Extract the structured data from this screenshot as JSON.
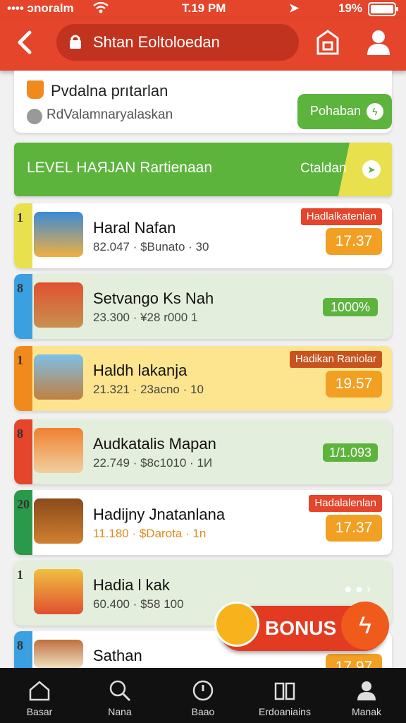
{
  "status": {
    "carrier": "•••• ɔnoralm",
    "time": "T.19 PM",
    "battery": "19%"
  },
  "header": {
    "search_text": "Shtan Eoltoloedan"
  },
  "top_card": {
    "title": "Pvdalna prıtarlan",
    "subtitle": "RdValamnaryalaskan",
    "button_label": "Pohaban"
  },
  "level_banner": {
    "title": "LEVEL HAЯJAN Rartienaan",
    "action_label": "Ctaldan"
  },
  "rows": [
    {
      "rank": "1",
      "name": "Haral Nafan",
      "sub": "82.047 · $Bunato · 30",
      "tag": "Hadlalkatenlan",
      "amount": "17.37"
    },
    {
      "rank": "8",
      "name": "Setvango Ks Nah",
      "sub": "23.300 · ¥28 r000 1",
      "tag": "",
      "amount": "1000%"
    },
    {
      "rank": "1",
      "name": "Haldh lakanja",
      "sub": "21.321 · 23acno · 10",
      "tag": "Hadikan Raniolar",
      "amount": "19.57"
    },
    {
      "rank": "8",
      "name": "Audkatalis Mapan",
      "sub": "22.749 · $8c1010 · 1И",
      "tag": "",
      "amount": "1/1.093"
    },
    {
      "rank": "20",
      "name": "Hadijny Jnatanlana",
      "sub": "11.180 · $Darota · 1n",
      "tag": "Hadalalenlan",
      "amount": "17.37"
    },
    {
      "rank": "1",
      "name": "Hadia l kak",
      "sub": "60.400 · $58 100",
      "tag": "",
      "amount": ""
    },
    {
      "rank": "8",
      "name": "Sathan",
      "sub": "",
      "tag": "",
      "amount": "17.97"
    }
  ],
  "bonus": {
    "label": "BONUS"
  },
  "nav": [
    "Basar",
    "Nana",
    "Baao",
    "Erdoaniains",
    "Manak"
  ],
  "colors": {
    "brand": "#e4452b",
    "green": "#5cb43c",
    "orange": "#f1a024",
    "yellow": "#fde58f"
  }
}
